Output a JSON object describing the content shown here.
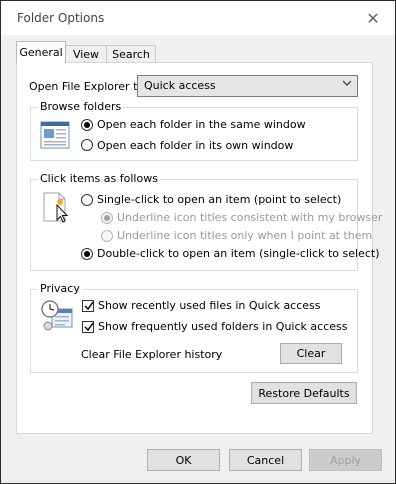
{
  "window": {
    "title": "Folder Options"
  },
  "tabs": [
    {
      "label": "General"
    },
    {
      "label": "View"
    },
    {
      "label": "Search"
    }
  ],
  "open_explorer": {
    "label": "Open File Explorer to:",
    "value": "Quick access"
  },
  "browse": {
    "title": "Browse folders",
    "options": [
      {
        "label": "Open each folder in the same window",
        "checked": true
      },
      {
        "label": "Open each folder in its own window",
        "checked": false
      }
    ]
  },
  "click": {
    "title": "Click items as follows",
    "single": "Single-click to open an item (point to select)",
    "underline_browser": "Underline icon titles consistent with my browser",
    "underline_point": "Underline icon titles only when I point at them",
    "double": "Double-click to open an item (single-click to select)"
  },
  "privacy": {
    "title": "Privacy",
    "recent_files": "Show recently used files in Quick access",
    "frequent_folders": "Show frequently used folders in Quick access",
    "clear_label": "Clear File Explorer history",
    "clear_button": "Clear"
  },
  "buttons": {
    "restore": "Restore Defaults",
    "ok": "OK",
    "cancel": "Cancel",
    "apply": "Apply"
  }
}
